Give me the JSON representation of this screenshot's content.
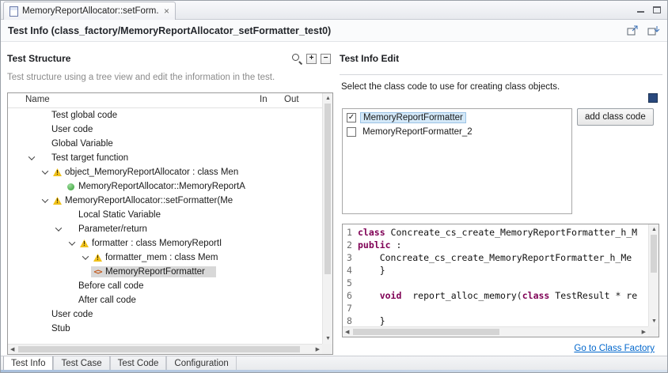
{
  "window": {
    "tab_title": "MemoryReportAllocator::setForm..."
  },
  "header": {
    "title": "Test Info (class_factory/MemoryReportAllocator_setFormatter_test0)"
  },
  "test_structure": {
    "title": "Test Structure",
    "description": "Test structure using a tree view and edit the information in the test.",
    "columns": [
      "Name",
      "In",
      "Out"
    ],
    "rows": [
      {
        "label": "Test global code",
        "indent": 1
      },
      {
        "label": "User code",
        "indent": 1
      },
      {
        "label": "Global Variable",
        "indent": 1
      },
      {
        "label": "Test target function",
        "indent": 1,
        "chevron": true
      },
      {
        "label": "object_MemoryReportAllocator  :  class Men",
        "indent": 2,
        "chevron": true,
        "icon": "warning"
      },
      {
        "label": "MemoryReportAllocator::MemoryReportA",
        "indent": 3,
        "icon": "constructor"
      },
      {
        "label": "MemoryReportAllocator::setFormatter(Me",
        "indent": 2,
        "chevron": true,
        "icon": "warning"
      },
      {
        "label": "Local Static Variable",
        "indent": 3
      },
      {
        "label": "Parameter/return",
        "indent": 3,
        "chevron": true
      },
      {
        "label": "formatter  :  class MemoryReportI",
        "indent": 4,
        "chevron": true,
        "icon": "warning"
      },
      {
        "label": "formatter_mem  :  class Mem",
        "indent": 5,
        "chevron": true,
        "icon": "warning"
      },
      {
        "label": "MemoryReportFormatter",
        "indent": 5,
        "icon": "classref",
        "selected": true
      },
      {
        "label": "Before call code",
        "indent": 3
      },
      {
        "label": "After call code",
        "indent": 3
      },
      {
        "label": "User code",
        "indent": 1
      },
      {
        "label": "Stub",
        "indent": 1
      }
    ]
  },
  "test_info_edit": {
    "title": "Test Info Edit",
    "instruction": "Select the class code to use for creating class objects.",
    "add_button_label": "add class code",
    "class_options": [
      {
        "label": "MemoryReportFormatter",
        "checked": true,
        "selected": true
      },
      {
        "label": "MemoryReportFormatter_2",
        "checked": false,
        "selected": false
      }
    ],
    "code_lines": [
      {
        "num": "1",
        "segments": [
          {
            "text": "class",
            "keyword": true
          },
          {
            "text": " Concreate_cs_create_MemoryReportFormatter_h_M",
            "keyword": false
          }
        ]
      },
      {
        "num": "2",
        "segments": [
          {
            "text": "public",
            "keyword": true
          },
          {
            "text": " :",
            "keyword": false
          }
        ]
      },
      {
        "num": "3",
        "segments": [
          {
            "text": "    Concreate_cs_create_MemoryReportFormatter_h_Me",
            "keyword": false
          }
        ]
      },
      {
        "num": "4",
        "segments": [
          {
            "text": "    }",
            "keyword": false
          }
        ]
      },
      {
        "num": "5",
        "segments": []
      },
      {
        "num": "6",
        "segments": [
          {
            "text": "    ",
            "keyword": false
          },
          {
            "text": "void",
            "keyword": true
          },
          {
            "text": "  report_alloc_memory(",
            "keyword": false
          },
          {
            "text": "class",
            "keyword": true
          },
          {
            "text": " TestResult * re",
            "keyword": false
          }
        ]
      },
      {
        "num": "7",
        "segments": []
      },
      {
        "num": "8",
        "segments": [
          {
            "text": "    }",
            "keyword": false
          }
        ]
      }
    ],
    "link_label": "Go to Class Factory"
  },
  "bottom_tabs": [
    {
      "label": "Test Info",
      "active": true
    },
    {
      "label": "Test Case",
      "active": false
    },
    {
      "label": "Test Code",
      "active": false
    },
    {
      "label": "Configuration",
      "active": false
    }
  ],
  "colors": {
    "keyword": "#7f0055",
    "link": "#0066cc",
    "warning": "#f1c21b",
    "tree_sel": "#d8d8d8",
    "list_sel": "#d3e8f8"
  }
}
